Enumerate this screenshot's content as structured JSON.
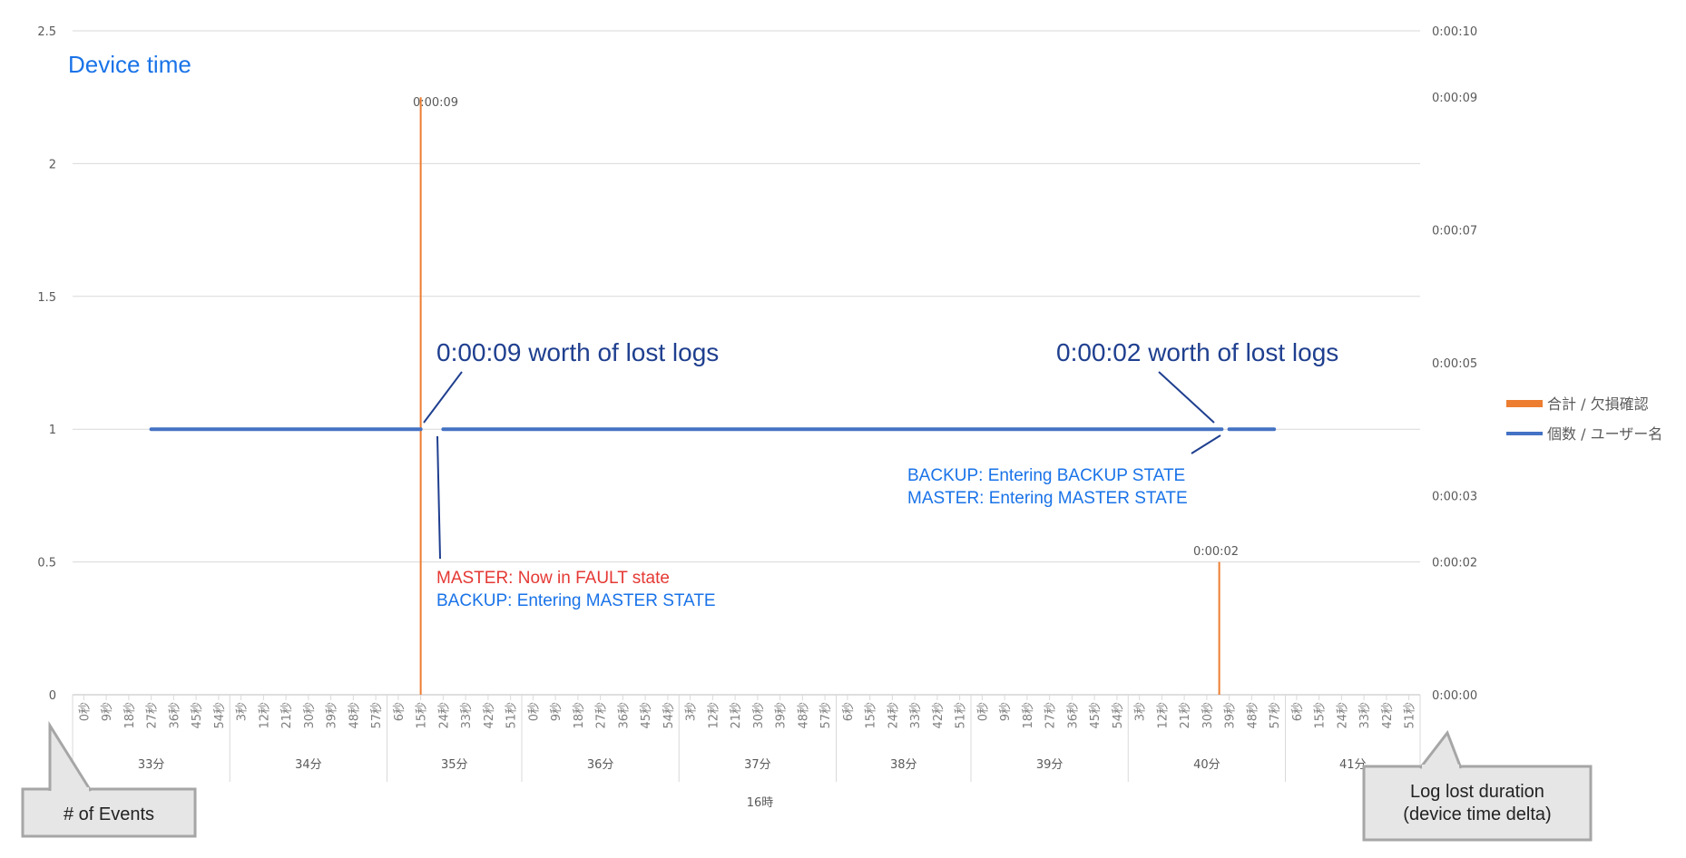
{
  "chart_data": {
    "type": "bar+line",
    "title": "Device time",
    "left_axis": {
      "min": 0,
      "max": 2.5,
      "ticks": [
        "0",
        "0.5",
        "1",
        "1.5",
        "2",
        "2.5"
      ]
    },
    "right_axis": {
      "ticks": [
        "0:00:00",
        "0:00:02",
        "0:00:03",
        "0:00:05",
        "0:00:07",
        "0:00:09",
        "0:00:10"
      ]
    },
    "x_axis": {
      "hour_label": "16時",
      "second_ticks": [
        {
          "minute": "33分",
          "seconds": [
            "0秒",
            "9秒",
            "18秒",
            "27秒",
            "36秒",
            "45秒",
            "54秒"
          ]
        },
        {
          "minute": "34分",
          "seconds": [
            "3秒",
            "12秒",
            "21秒",
            "30秒",
            "39秒",
            "48秒",
            "57秒"
          ]
        },
        {
          "minute": "35分",
          "seconds": [
            "6秒",
            "15秒",
            "24秒",
            "33秒",
            "42秒",
            "51秒"
          ]
        },
        {
          "minute": "36分",
          "seconds": [
            "0秒",
            "9秒",
            "18秒",
            "27秒",
            "36秒",
            "45秒",
            "54秒"
          ]
        },
        {
          "minute": "37分",
          "seconds": [
            "3秒",
            "12秒",
            "21秒",
            "30秒",
            "39秒",
            "48秒",
            "57秒"
          ]
        },
        {
          "minute": "38分",
          "seconds": [
            "6秒",
            "15秒",
            "24秒",
            "33秒",
            "42秒",
            "51秒"
          ]
        },
        {
          "minute": "39分",
          "seconds": [
            "0秒",
            "9秒",
            "18秒",
            "27秒",
            "36秒",
            "45秒",
            "54秒"
          ]
        },
        {
          "minute": "40分",
          "seconds": [
            "3秒",
            "12秒",
            "21秒",
            "30秒",
            "39秒",
            "48秒",
            "57秒"
          ]
        },
        {
          "minute": "41分",
          "seconds": [
            "6秒",
            "15秒",
            "24秒",
            "33秒",
            "42秒",
            "51秒"
          ]
        }
      ]
    },
    "series": [
      {
        "name": "合計 / 欠損確認",
        "kind": "bar",
        "axis": "right",
        "color": "#ed7d31",
        "points": [
          {
            "minute": "35分",
            "second": 15,
            "value": "0:00:09"
          },
          {
            "minute": "40分",
            "second": 35,
            "value": "0:00:02"
          }
        ]
      },
      {
        "name": "個数 / ユーザー名",
        "kind": "line",
        "axis": "left",
        "color": "#4472c4",
        "segments": [
          {
            "from": {
              "minute": "33分",
              "second": 27
            },
            "to": {
              "minute": "35分",
              "second": 15
            },
            "value": 1
          },
          {
            "from": {
              "minute": "35分",
              "second": 24
            },
            "to": {
              "minute": "40分",
              "second": 36
            },
            "value": 1
          },
          {
            "from": {
              "minute": "40分",
              "second": 39
            },
            "to": {
              "minute": "40分",
              "second": 57
            },
            "value": 1
          }
        ]
      }
    ],
    "bar_labels": [
      "0:00:09",
      "0:00:02"
    ],
    "annotations": {
      "lost_logs_1": "0:00:09 worth of lost logs",
      "lost_logs_2": "0:00:02 worth of lost logs",
      "event_1_line1": "MASTER: Now in FAULT state",
      "event_1_line2": "BACKUP: Entering MASTER STATE",
      "event_2_line1": "BACKUP: Entering BACKUP STATE",
      "event_2_line2": "MASTER: Entering MASTER STATE"
    },
    "callouts": {
      "left": "# of Events",
      "right_line1": "Log lost duration",
      "right_line2": "(device time delta)"
    },
    "legend_position": "right",
    "grid": true
  },
  "colors": {
    "bar": "#ed7d31",
    "line": "#4472c4",
    "title": "#1a73e8",
    "big_annotation": "#1f3f8f",
    "fault": "#e53935",
    "event": "#1a73e8",
    "callout_fill": "#e6e6e6",
    "callout_stroke": "#a6a6a6"
  }
}
